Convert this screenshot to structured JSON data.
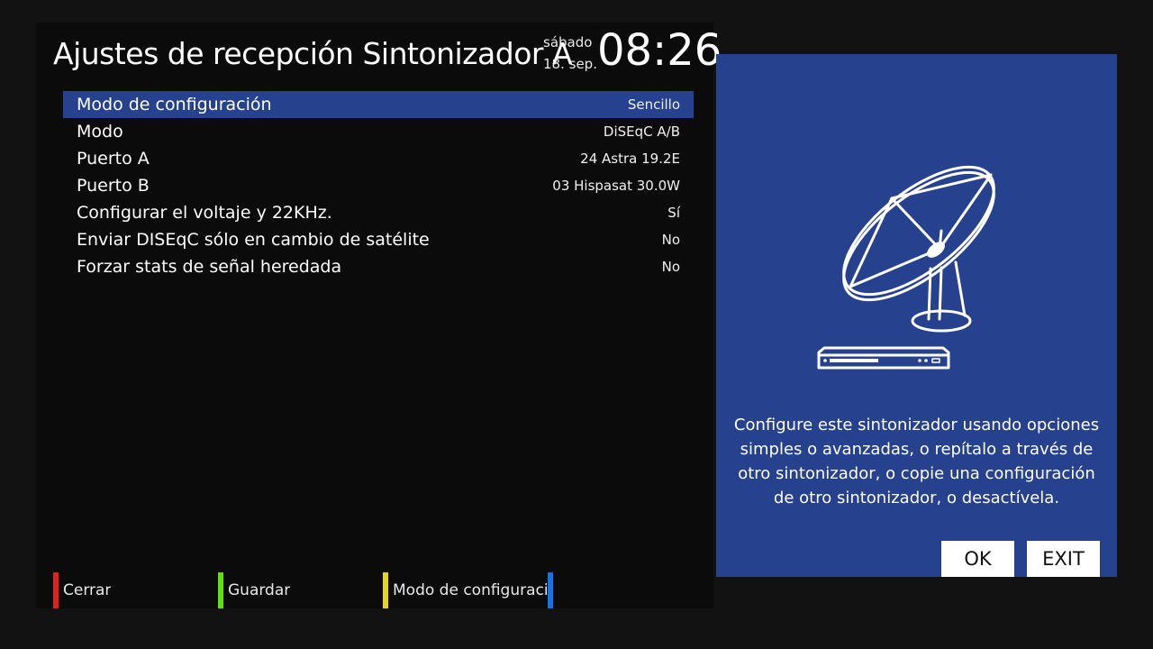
{
  "header": {
    "title": "Ajustes de recepción Sintonizador A",
    "day": "sábado",
    "date": "18. sep.",
    "time": "08:26"
  },
  "menu": [
    {
      "label": "Modo de configuración",
      "value": "Sencillo",
      "selected": true
    },
    {
      "label": "Modo",
      "value": "DiSEqC A/B",
      "selected": false
    },
    {
      "label": "Puerto A",
      "value": "24 Astra 19.2E",
      "selected": false
    },
    {
      "label": "Puerto B",
      "value": "03 Hispasat 30.0W",
      "selected": false
    },
    {
      "label": "Configurar el voltaje y 22KHz.",
      "value": "Sí",
      "selected": false
    },
    {
      "label": "Enviar DISEqC sólo en cambio de satélite",
      "value": "No",
      "selected": false
    },
    {
      "label": "Forzar stats de señal heredada",
      "value": "No",
      "selected": false
    }
  ],
  "footer": {
    "red": "Cerrar",
    "green": "Guardar",
    "yellow": "Modo de configuración",
    "blue": ""
  },
  "help": {
    "icon": "satellite-dish-icon",
    "text": "Configure este sintonizador usando opciones simples o avanzadas, o repítalo a través de otro sintonizador, o copie una configuración de otro sintonizador, o desactívela.",
    "ok_label": "OK",
    "exit_label": "EXIT"
  },
  "colors": {
    "accent": "#26418d",
    "red": "#e3201b",
    "green": "#5ee011",
    "yellow": "#e6d31c",
    "blue": "#1473e6"
  }
}
